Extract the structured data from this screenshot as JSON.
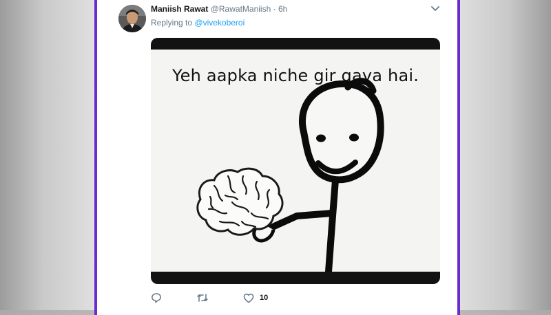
{
  "tweet": {
    "display_name": "Maniish Rawat",
    "handle": "@RawatManiish",
    "separator": "·",
    "time": "6h",
    "replying_prefix": "Replying to",
    "replying_to": "@vivekoberoi",
    "meme_text": "Yeh aapka niche gir gaya hai.",
    "like_count": "10"
  },
  "icons": [
    "avatar",
    "caret-down-icon",
    "reply-icon",
    "retweet-icon",
    "like-icon"
  ],
  "colors": {
    "frame": "#6a2ad0",
    "link": "#1da1f2",
    "muted": "#657786"
  }
}
